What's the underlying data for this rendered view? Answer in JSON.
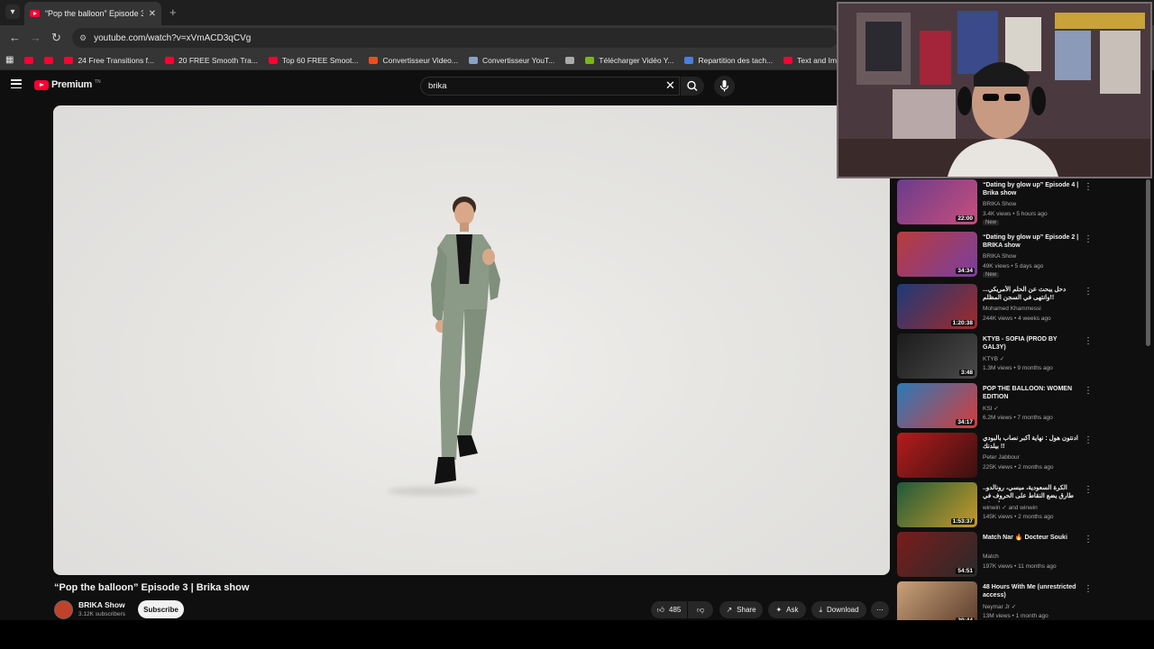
{
  "browser": {
    "tab_title": "“Pop the balloon” Episode 3 | Bri",
    "url": "youtube.com/watch?v=xVmACD3qCVg",
    "bookmarks": [
      {
        "label": "",
        "color": "#ff0033"
      },
      {
        "label": "",
        "color": "#ff0033"
      },
      {
        "label": "24 Free Transitions f...",
        "color": "#ff0033"
      },
      {
        "label": "20 FREE Smooth Tra...",
        "color": "#ff0033"
      },
      {
        "label": "Top 60 FREE Smoot...",
        "color": "#ff0033"
      },
      {
        "label": "Convertisseur Video...",
        "color": "#e8501f"
      },
      {
        "label": "Convertisseur YouT...",
        "color": "#8aa0c8"
      },
      {
        "label": "",
        "color": "#aaaaaa"
      },
      {
        "label": "Télécharger Vidéo Y...",
        "color": "#7ab51d"
      },
      {
        "label": "Repartition des tach...",
        "color": "#4a7fdc"
      },
      {
        "label": "Text and Image ani...",
        "color": "#ff0033"
      }
    ]
  },
  "youtube": {
    "logo_text": "Premium",
    "logo_sup": "TN",
    "search_value": "brika"
  },
  "video": {
    "title": "“Pop the balloon” Episode 3 | Brika show",
    "channel_name": "BRIKA Show",
    "channel_subs": "3.12K subscribers",
    "subscribe_label": "Subscribe",
    "like_count": "485",
    "share_label": "Share",
    "ask_label": "Ask",
    "download_label": "Download"
  },
  "recommendations": [
    {
      "title": "“Dating by glow up” Episode 4 | Brika show",
      "channel": "BRIKA Show",
      "meta": "3.4K views • 5 hours ago",
      "badge": "New",
      "duration": "22:00",
      "thumb": [
        "#6a3c8a",
        "#c84e7e"
      ]
    },
    {
      "title": "“Dating by glow up” Episode 2 | BRIKA show",
      "channel": "BRIKA Show",
      "meta": "49K views • 5 days ago",
      "badge": "New",
      "duration": "34:34",
      "thumb": [
        "#b93b3b",
        "#7a3fa0"
      ]
    },
    {
      "title": "دحل يبحث عن الحلم الأمريكي... وانتهى في السجن المظلم!!",
      "channel": "Mohamed Khammessi",
      "meta": "244K views • 4 weeks ago",
      "badge": "",
      "duration": "1:20:38",
      "thumb": [
        "#1c3a7a",
        "#a22a2a"
      ]
    },
    {
      "title": "KTYB - SOFIA (PROD BY GAL3Y)",
      "channel": "KTYB ✓",
      "meta": "1.3M views • 9 months ago",
      "badge": "",
      "duration": "3:48",
      "thumb": [
        "#1c1c1c",
        "#4a4a4a"
      ]
    },
    {
      "title": "POP THE BALLOON: WOMEN EDITION",
      "channel": "KSI ✓",
      "meta": "6.2M views • 7 months ago",
      "badge": "",
      "duration": "34:17",
      "thumb": [
        "#2a7ab8",
        "#d63b3b"
      ]
    },
    {
      "title": "ادنتون هول : نهاية أكبر نصاب بالبودي بيلدنك !!",
      "channel": "Peter Jabbour",
      "meta": "225K views • 2 months ago",
      "badge": "",
      "duration": "",
      "thumb": [
        "#b51c1c",
        "#3a1010"
      ]
    },
    {
      "title": "الكرة السعودية، ميسي، رونالدو.. طارق يضع النقاط على الحروف في حوار مثير",
      "channel": "winwin ✓ and winwin",
      "meta": "145K views • 2 months ago",
      "badge": "",
      "duration": "1:53:37",
      "thumb": [
        "#1f5a3a",
        "#c89a2a"
      ]
    },
    {
      "title": "Match Nar 🔥 Docteur Souki",
      "channel": "Match",
      "meta": "197K views • 11 months ago",
      "badge": "",
      "duration": "54:51",
      "thumb": [
        "#7a1c1c",
        "#2a2a2a"
      ]
    },
    {
      "title": "48 Hours With Me (unrestricted access)",
      "channel": "Neymar Jr ✓",
      "meta": "13M views • 1 month ago",
      "badge": "",
      "duration": "20:44",
      "thumb": [
        "#c9a27a",
        "#5a3a2a"
      ]
    }
  ]
}
